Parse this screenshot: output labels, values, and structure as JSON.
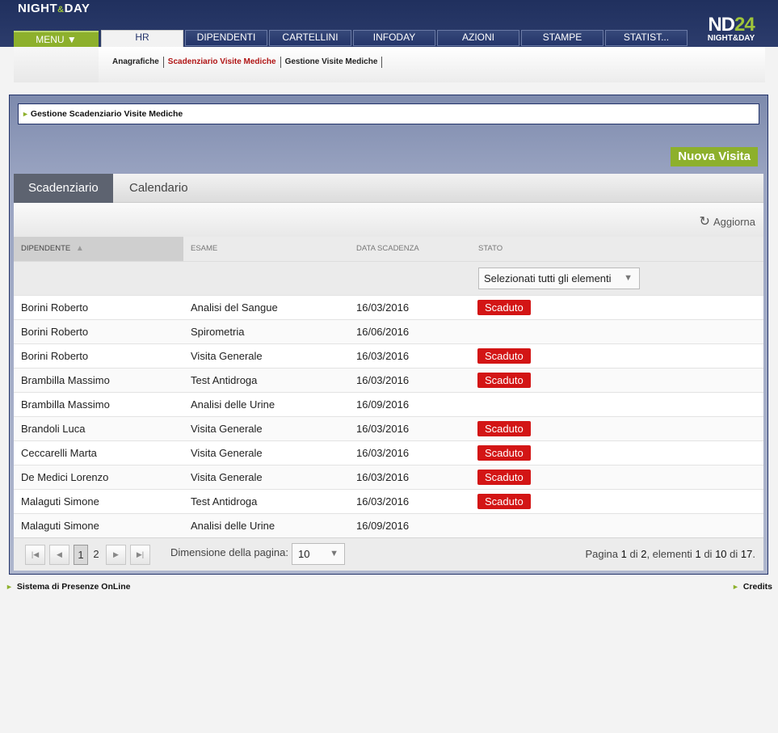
{
  "header": {
    "brand": {
      "night": "NIGHT",
      "amp": "&",
      "day": "DAY"
    },
    "logo": {
      "nd": "ND",
      "num": "24",
      "sub": "NIGHT&DAY"
    },
    "menu_label": "MENU ▼",
    "nav_tabs": [
      "HR",
      "DIPENDENTI",
      "CARTELLINI",
      "INFODAY",
      "AZIONI",
      "STAMPE",
      "STATIST..."
    ],
    "sub_links": [
      "Anagrafiche",
      "Scadenziario Visite Mediche",
      "Gestione Visite Mediche"
    ]
  },
  "page": {
    "title": "Gestione Scadenziario Visite Mediche",
    "new_button": "Nuova Visita"
  },
  "tabs": [
    "Scadenziario",
    "Calendario"
  ],
  "grid": {
    "refresh_label": "Aggiorna",
    "columns": [
      "DIPENDENTE",
      "ESAME",
      "DATA SCADENZA",
      "STATO"
    ],
    "filter_value": "Selezionati tutti gli elementi",
    "rows": [
      {
        "dipendente": "Borini Roberto",
        "esame": "Analisi del Sangue",
        "data": "16/03/2016",
        "stato": "Scaduto"
      },
      {
        "dipendente": "Borini Roberto",
        "esame": "Spirometria",
        "data": "16/06/2016",
        "stato": ""
      },
      {
        "dipendente": "Borini Roberto",
        "esame": "Visita Generale",
        "data": "16/03/2016",
        "stato": "Scaduto"
      },
      {
        "dipendente": "Brambilla Massimo",
        "esame": "Test Antidroga",
        "data": "16/03/2016",
        "stato": "Scaduto"
      },
      {
        "dipendente": "Brambilla Massimo",
        "esame": "Analisi delle Urine",
        "data": "16/09/2016",
        "stato": ""
      },
      {
        "dipendente": "Brandoli Luca",
        "esame": "Visita Generale",
        "data": "16/03/2016",
        "stato": "Scaduto"
      },
      {
        "dipendente": "Ceccarelli Marta",
        "esame": "Visita Generale",
        "data": "16/03/2016",
        "stato": "Scaduto"
      },
      {
        "dipendente": "De Medici Lorenzo",
        "esame": "Visita Generale",
        "data": "16/03/2016",
        "stato": "Scaduto"
      },
      {
        "dipendente": "Malaguti Simone",
        "esame": "Test Antidroga",
        "data": "16/03/2016",
        "stato": "Scaduto"
      },
      {
        "dipendente": "Malaguti Simone",
        "esame": "Analisi delle Urine",
        "data": "16/09/2016",
        "stato": ""
      }
    ]
  },
  "pager": {
    "pages": [
      "1",
      "2"
    ],
    "current_page": "1",
    "page_size_label": "Dimensione della pagina:",
    "page_size": "10",
    "info": {
      "pagina": "Pagina",
      "cur": "1",
      "di1": "di",
      "total_pages": "2",
      "elementi": ", elementi",
      "from": "1",
      "di2": "di",
      "to": "10",
      "di3": "di",
      "total": "17",
      "dot": "."
    }
  },
  "footer": {
    "left": "Sistema di Presenze OnLine",
    "right": "Credits"
  },
  "colors": {
    "navy": "#23336a",
    "accent_green": "#8db02c",
    "expired_red": "#d31515",
    "active_link": "#b01515"
  },
  "icons": {
    "refresh": "refresh-icon",
    "sort": "sort-asc-icon",
    "first": "first-page-icon",
    "prev": "prev-page-icon",
    "next": "next-page-icon",
    "last": "last-page-icon",
    "dropdown": "chevron-down-icon",
    "bullet": "arrow-right-icon"
  }
}
